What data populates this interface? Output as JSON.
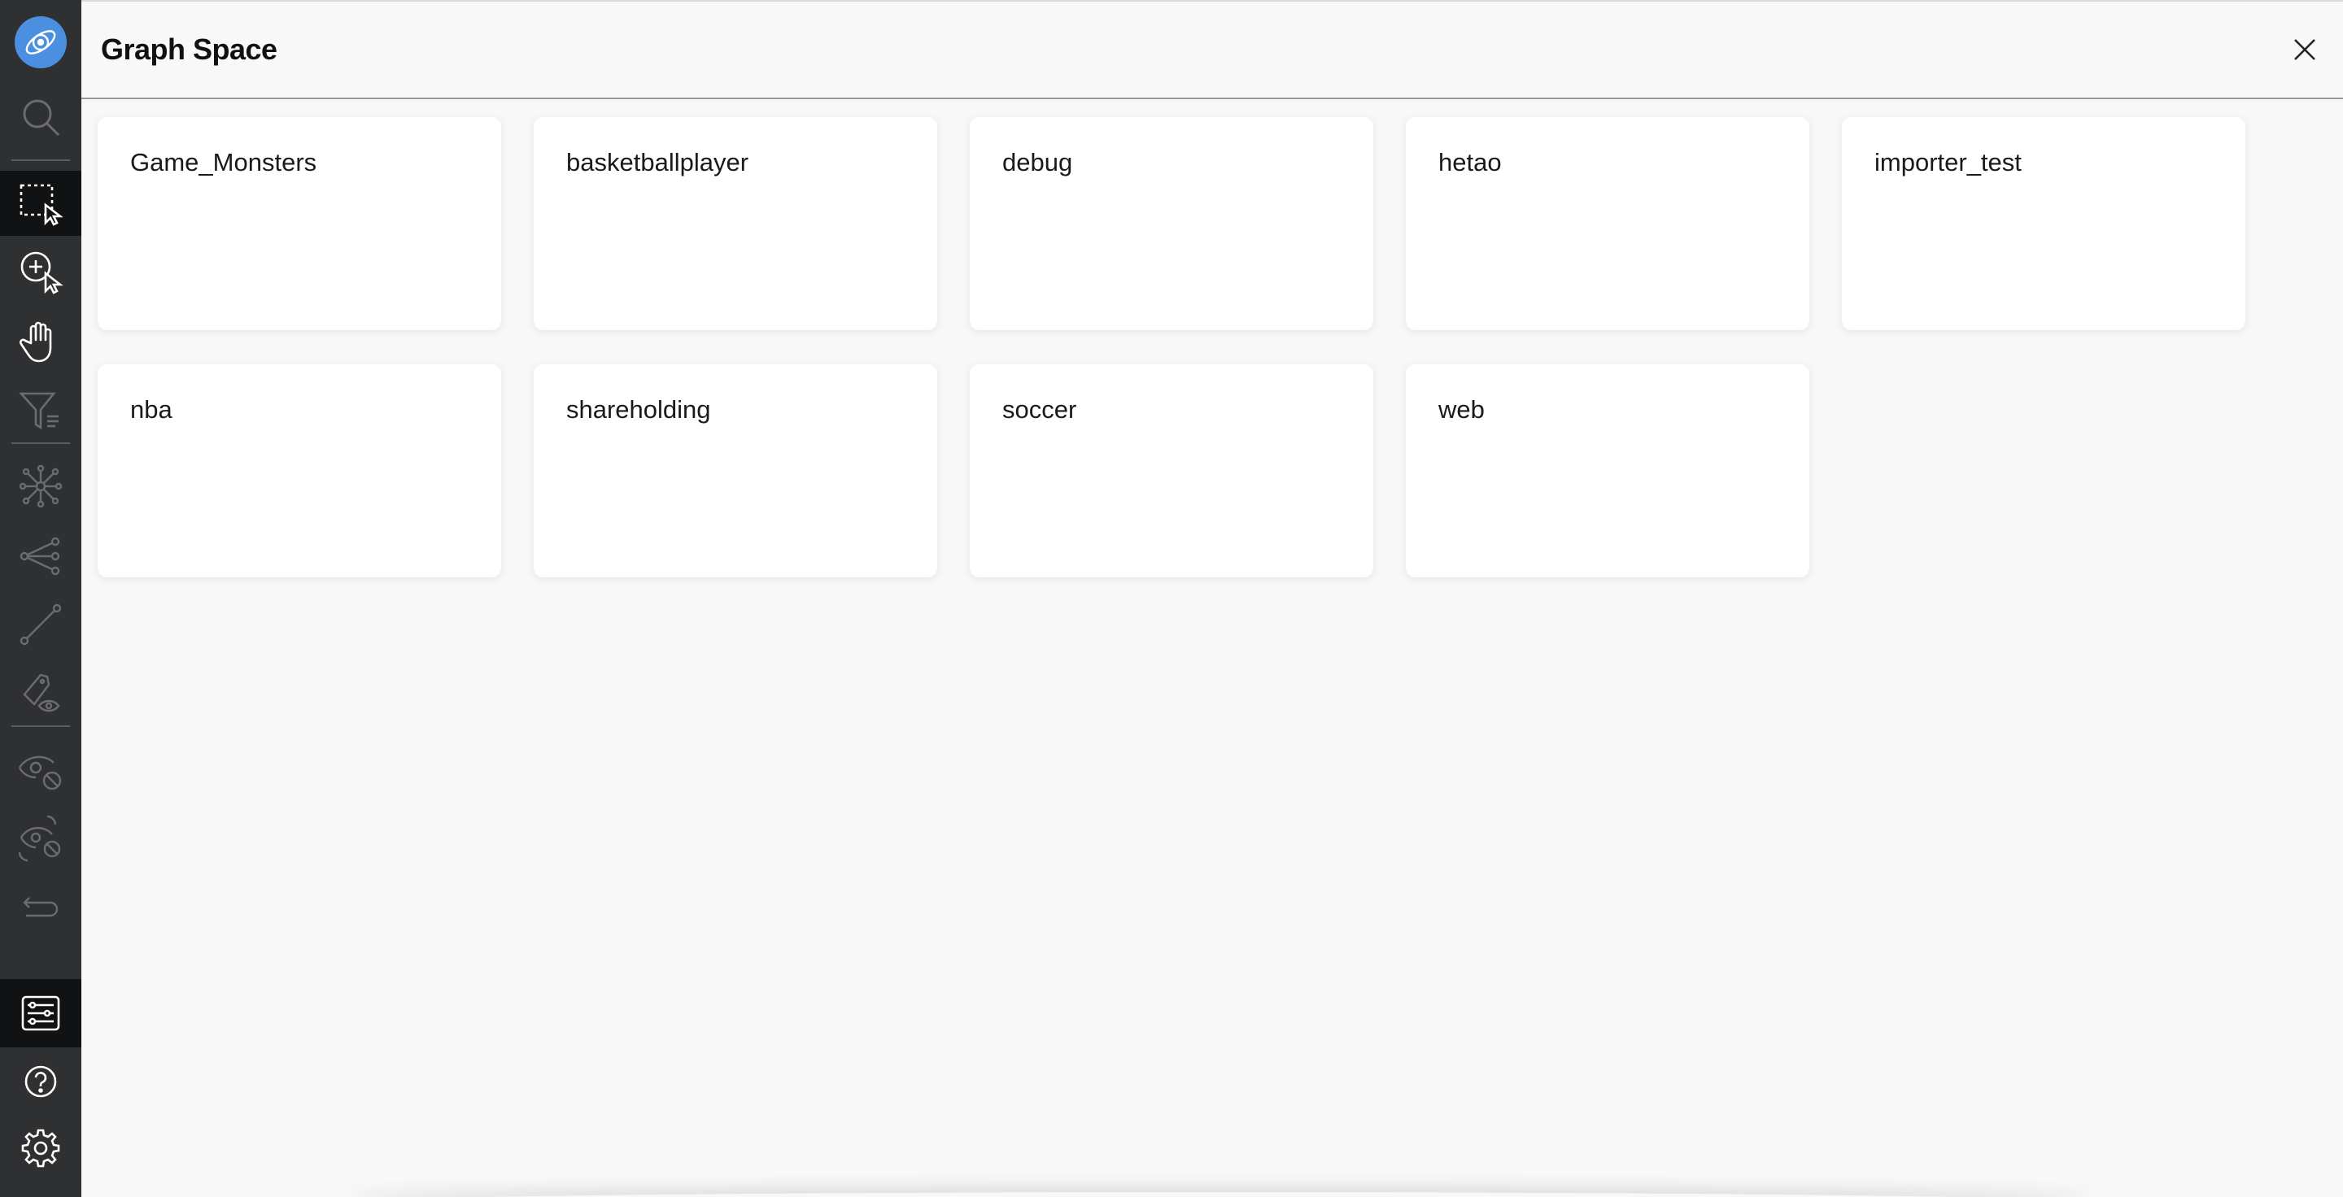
{
  "app": {
    "logo_icon": "nebula-logo-icon",
    "accent": "#4b8fe0"
  },
  "toolbar": {
    "tools": [
      {
        "name": "search-tool",
        "icon": "search-icon"
      },
      {
        "name": "box-select-tool",
        "icon": "box-select-icon",
        "active": true
      },
      {
        "name": "add-select-tool",
        "icon": "add-select-icon"
      },
      {
        "name": "pan-tool",
        "icon": "hand-icon"
      },
      {
        "name": "filter-tool",
        "icon": "filter-icon"
      },
      {
        "name": "expand-tool",
        "icon": "expand-graph-icon"
      },
      {
        "name": "common-neighbor-tool",
        "icon": "share-icon"
      },
      {
        "name": "path-tool",
        "icon": "path-icon"
      },
      {
        "name": "property-view-tool",
        "icon": "tag-eye-icon"
      },
      {
        "name": "hide-tool",
        "icon": "eye-hide-icon"
      },
      {
        "name": "hide-others-tool",
        "icon": "eye-hide-others-icon"
      },
      {
        "name": "undo-tool",
        "icon": "undo-icon"
      },
      {
        "name": "graph-space-tool",
        "icon": "list-settings-icon",
        "active": true
      },
      {
        "name": "help-tool",
        "icon": "help-icon"
      },
      {
        "name": "settings-tool",
        "icon": "gear-icon"
      }
    ]
  },
  "panel": {
    "title": "Graph Space",
    "close_icon": "close-icon",
    "spaces": [
      "Game_Monsters",
      "basketballplayer",
      "debug",
      "hetao",
      "importer_test",
      "nba",
      "shareholding",
      "soccer",
      "web"
    ]
  }
}
